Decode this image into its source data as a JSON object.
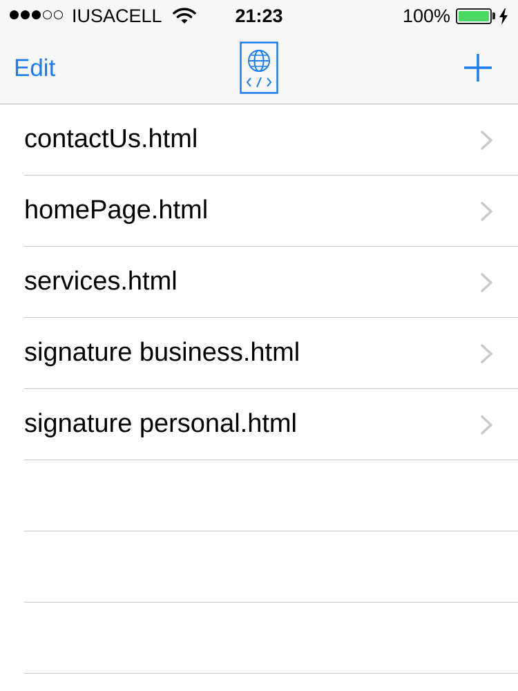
{
  "status_bar": {
    "signal_bars_filled": 3,
    "signal_bars_total": 5,
    "carrier": "IUSACELL",
    "time": "21:23",
    "battery_percent": "100%",
    "battery_level": 1.0,
    "charging": true
  },
  "nav_bar": {
    "edit_label": "Edit",
    "app_icon": "globe-code-icon",
    "add_icon": "plus-icon",
    "accent_color": "#1a7cf0"
  },
  "files": [
    {
      "name": "contactUs.html"
    },
    {
      "name": "homePage.html"
    },
    {
      "name": "services.html"
    },
    {
      "name": "signature business.html"
    },
    {
      "name": "signature personal.html"
    }
  ],
  "empty_rows": 3
}
